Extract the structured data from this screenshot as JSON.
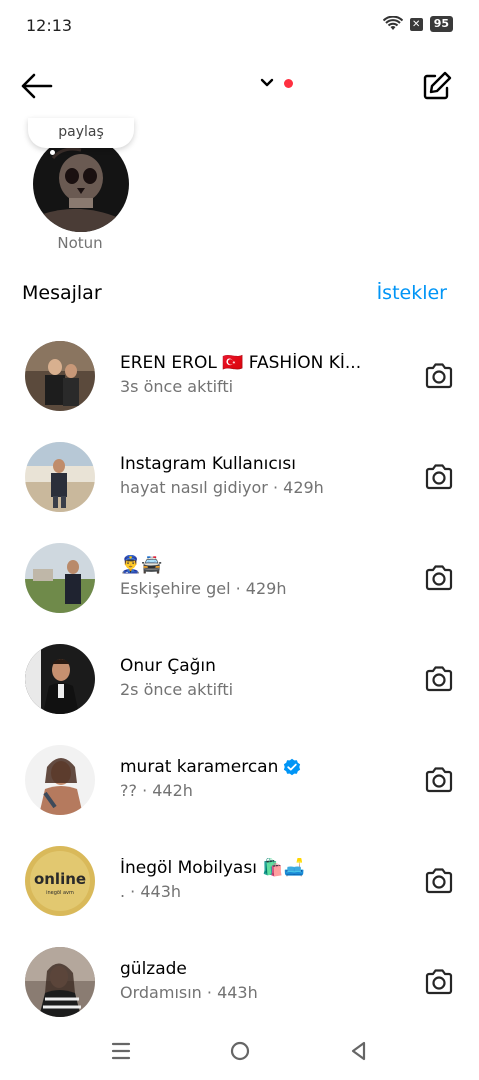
{
  "status": {
    "time": "12:13",
    "battery": "95"
  },
  "note": {
    "bubble_text": "paylaş",
    "label": "Notun"
  },
  "section": {
    "title": "Mesajlar",
    "requests": "İstekler"
  },
  "conversations": [
    {
      "name": "EREN EROL 🇹🇷 FASHİON Kİ...",
      "sub": "3s önce aktifti",
      "verified": false
    },
    {
      "name": "Instagram Kullanıcısı",
      "sub": "hayat nasıl gidiyor · 429h",
      "verified": false
    },
    {
      "name": "👮‍♂️🚔",
      "sub": "Eskişehire gel · 429h",
      "verified": false
    },
    {
      "name": "Onur Çağın",
      "sub": "2s önce aktifti",
      "verified": false
    },
    {
      "name": "murat karamercan",
      "sub": "?? · 442h",
      "verified": true
    },
    {
      "name": "İnegöl Mobilyası 🛍️🛋️",
      "sub": ". · 443h",
      "verified": false
    },
    {
      "name": "gülzade",
      "sub": "Ordamısın · 443h",
      "verified": false
    }
  ],
  "icons": {
    "back": "arrow-left-icon",
    "compose": "edit-icon",
    "camera": "camera-icon",
    "nav_menu": "menu-icon",
    "nav_home": "circle-home-icon",
    "nav_back": "triangle-back-icon"
  },
  "colors": {
    "accent": "#0095f6",
    "dot": "#ff3040"
  }
}
